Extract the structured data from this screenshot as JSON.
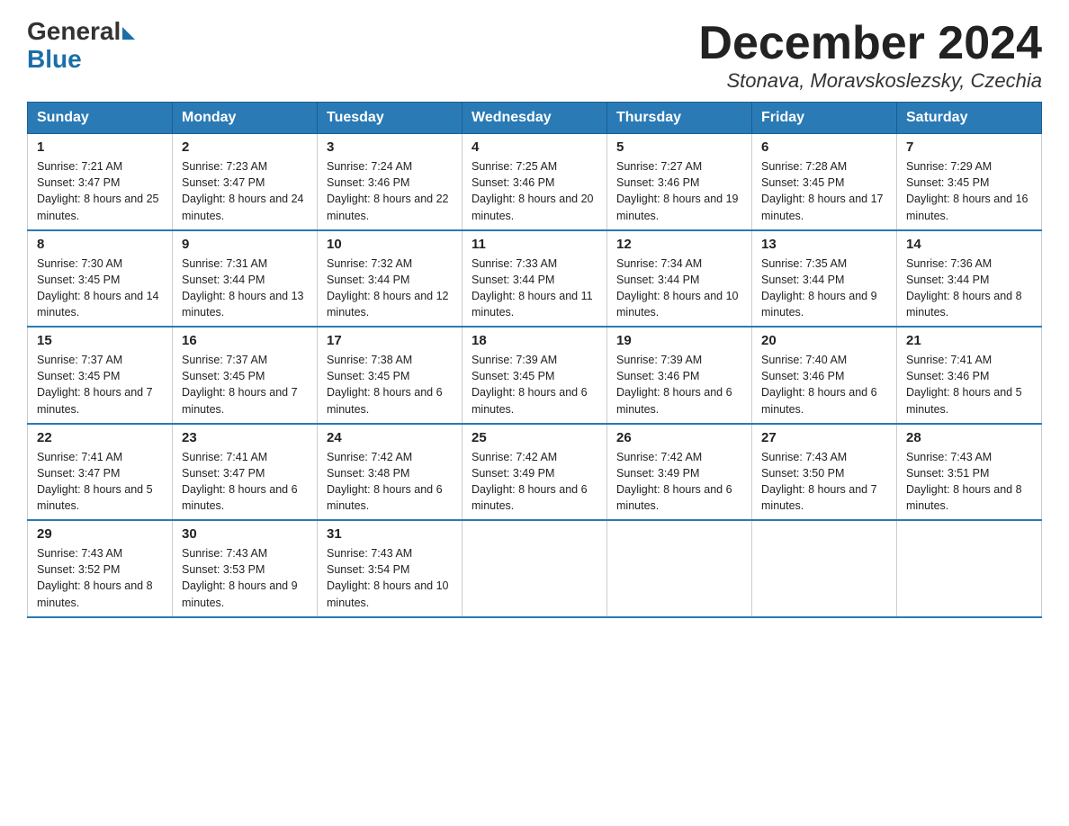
{
  "header": {
    "logo_general": "General",
    "logo_blue": "Blue",
    "month_title": "December 2024",
    "location": "Stonava, Moravskoslezsky, Czechia"
  },
  "weekdays": [
    "Sunday",
    "Monday",
    "Tuesday",
    "Wednesday",
    "Thursday",
    "Friday",
    "Saturday"
  ],
  "weeks": [
    [
      {
        "day": "1",
        "sunrise": "7:21 AM",
        "sunset": "3:47 PM",
        "daylight": "8 hours and 25 minutes."
      },
      {
        "day": "2",
        "sunrise": "7:23 AM",
        "sunset": "3:47 PM",
        "daylight": "8 hours and 24 minutes."
      },
      {
        "day": "3",
        "sunrise": "7:24 AM",
        "sunset": "3:46 PM",
        "daylight": "8 hours and 22 minutes."
      },
      {
        "day": "4",
        "sunrise": "7:25 AM",
        "sunset": "3:46 PM",
        "daylight": "8 hours and 20 minutes."
      },
      {
        "day": "5",
        "sunrise": "7:27 AM",
        "sunset": "3:46 PM",
        "daylight": "8 hours and 19 minutes."
      },
      {
        "day": "6",
        "sunrise": "7:28 AM",
        "sunset": "3:45 PM",
        "daylight": "8 hours and 17 minutes."
      },
      {
        "day": "7",
        "sunrise": "7:29 AM",
        "sunset": "3:45 PM",
        "daylight": "8 hours and 16 minutes."
      }
    ],
    [
      {
        "day": "8",
        "sunrise": "7:30 AM",
        "sunset": "3:45 PM",
        "daylight": "8 hours and 14 minutes."
      },
      {
        "day": "9",
        "sunrise": "7:31 AM",
        "sunset": "3:44 PM",
        "daylight": "8 hours and 13 minutes."
      },
      {
        "day": "10",
        "sunrise": "7:32 AM",
        "sunset": "3:44 PM",
        "daylight": "8 hours and 12 minutes."
      },
      {
        "day": "11",
        "sunrise": "7:33 AM",
        "sunset": "3:44 PM",
        "daylight": "8 hours and 11 minutes."
      },
      {
        "day": "12",
        "sunrise": "7:34 AM",
        "sunset": "3:44 PM",
        "daylight": "8 hours and 10 minutes."
      },
      {
        "day": "13",
        "sunrise": "7:35 AM",
        "sunset": "3:44 PM",
        "daylight": "8 hours and 9 minutes."
      },
      {
        "day": "14",
        "sunrise": "7:36 AM",
        "sunset": "3:44 PM",
        "daylight": "8 hours and 8 minutes."
      }
    ],
    [
      {
        "day": "15",
        "sunrise": "7:37 AM",
        "sunset": "3:45 PM",
        "daylight": "8 hours and 7 minutes."
      },
      {
        "day": "16",
        "sunrise": "7:37 AM",
        "sunset": "3:45 PM",
        "daylight": "8 hours and 7 minutes."
      },
      {
        "day": "17",
        "sunrise": "7:38 AM",
        "sunset": "3:45 PM",
        "daylight": "8 hours and 6 minutes."
      },
      {
        "day": "18",
        "sunrise": "7:39 AM",
        "sunset": "3:45 PM",
        "daylight": "8 hours and 6 minutes."
      },
      {
        "day": "19",
        "sunrise": "7:39 AM",
        "sunset": "3:46 PM",
        "daylight": "8 hours and 6 minutes."
      },
      {
        "day": "20",
        "sunrise": "7:40 AM",
        "sunset": "3:46 PM",
        "daylight": "8 hours and 6 minutes."
      },
      {
        "day": "21",
        "sunrise": "7:41 AM",
        "sunset": "3:46 PM",
        "daylight": "8 hours and 5 minutes."
      }
    ],
    [
      {
        "day": "22",
        "sunrise": "7:41 AM",
        "sunset": "3:47 PM",
        "daylight": "8 hours and 5 minutes."
      },
      {
        "day": "23",
        "sunrise": "7:41 AM",
        "sunset": "3:47 PM",
        "daylight": "8 hours and 6 minutes."
      },
      {
        "day": "24",
        "sunrise": "7:42 AM",
        "sunset": "3:48 PM",
        "daylight": "8 hours and 6 minutes."
      },
      {
        "day": "25",
        "sunrise": "7:42 AM",
        "sunset": "3:49 PM",
        "daylight": "8 hours and 6 minutes."
      },
      {
        "day": "26",
        "sunrise": "7:42 AM",
        "sunset": "3:49 PM",
        "daylight": "8 hours and 6 minutes."
      },
      {
        "day": "27",
        "sunrise": "7:43 AM",
        "sunset": "3:50 PM",
        "daylight": "8 hours and 7 minutes."
      },
      {
        "day": "28",
        "sunrise": "7:43 AM",
        "sunset": "3:51 PM",
        "daylight": "8 hours and 8 minutes."
      }
    ],
    [
      {
        "day": "29",
        "sunrise": "7:43 AM",
        "sunset": "3:52 PM",
        "daylight": "8 hours and 8 minutes."
      },
      {
        "day": "30",
        "sunrise": "7:43 AM",
        "sunset": "3:53 PM",
        "daylight": "8 hours and 9 minutes."
      },
      {
        "day": "31",
        "sunrise": "7:43 AM",
        "sunset": "3:54 PM",
        "daylight": "8 hours and 10 minutes."
      },
      null,
      null,
      null,
      null
    ]
  ]
}
